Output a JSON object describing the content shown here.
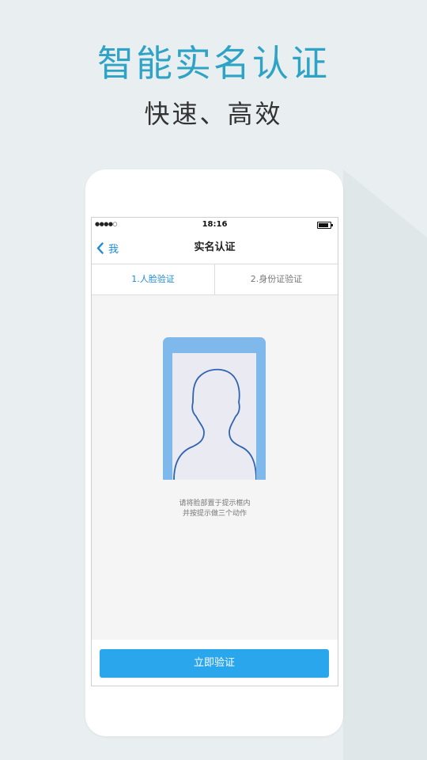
{
  "promo": {
    "headline": "智能实名认证",
    "subline": "快速、高效"
  },
  "status_bar": {
    "signal": "●●●●○",
    "time": "18:16",
    "battery_level": 0.85
  },
  "nav": {
    "back_label": "我",
    "title": "实名认证"
  },
  "tabs": [
    {
      "label": "1.人脸验证",
      "active": true
    },
    {
      "label": "2.身份证验证",
      "active": false
    }
  ],
  "hint": {
    "line1": "请将脸部置于提示框内",
    "line2": "并按提示做三个动作"
  },
  "primary_button": {
    "label": "立即验证"
  },
  "icons": {
    "back": "chevron-left-icon",
    "face": "face-silhouette-icon",
    "battery": "battery-icon"
  },
  "colors": {
    "accent": "#2fa3c6",
    "nav_link": "#1e8ad6",
    "button": "#2aa6ec",
    "frame": "#7fb9eb",
    "background": "#e9eff0"
  }
}
